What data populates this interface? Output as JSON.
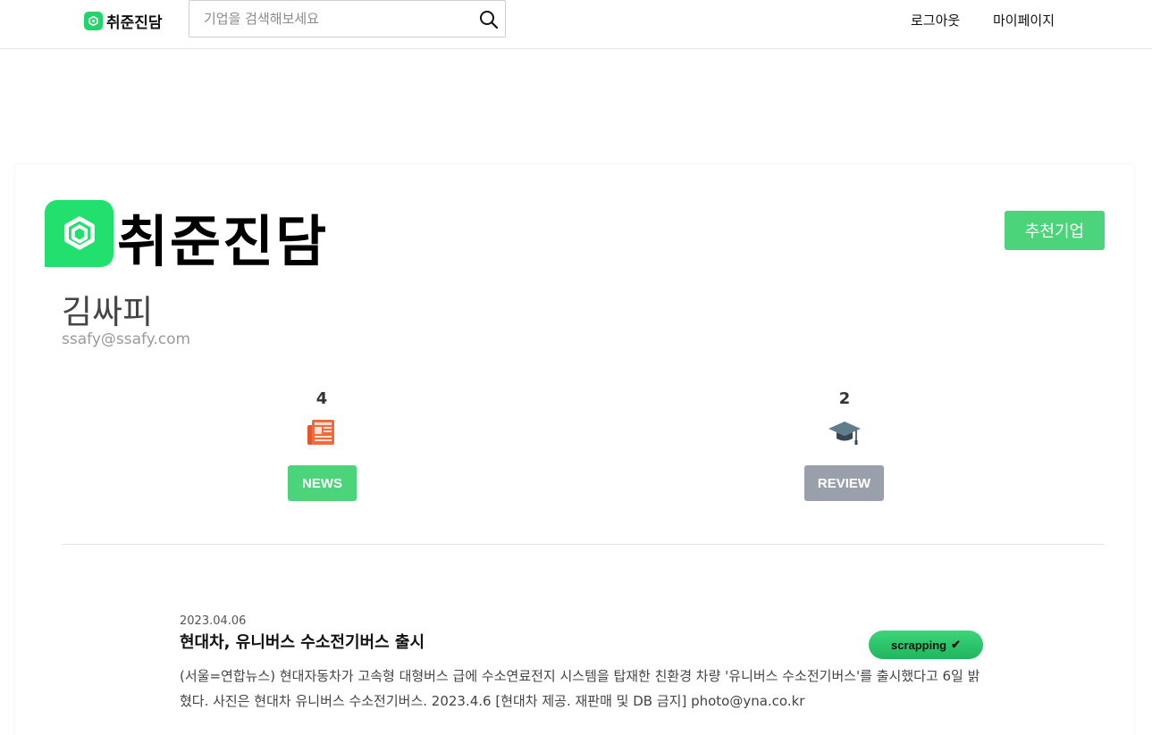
{
  "header": {
    "brand": "취준진담",
    "search_placeholder": "기업을 검색해보세요",
    "nav": {
      "logout": "로그아웃",
      "mypage": "마이페이지"
    }
  },
  "profile": {
    "brand": "취준진담",
    "recommend_label": "추천기업",
    "name": "김싸피",
    "email": "ssafy@ssafy.com"
  },
  "stats": {
    "news": {
      "count": "4",
      "label": "NEWS",
      "icon": "newspaper-icon"
    },
    "review": {
      "count": "2",
      "label": "REVIEW",
      "icon": "graduation-cap-icon"
    }
  },
  "news_list": [
    {
      "date": "2023.04.06",
      "title": "현대차, 유니버스 수소전기버스 출시",
      "body": "(서울=연합뉴스) 현대자동차가 고속형 대형버스 급에 수소연료전지 시스템을 탑재한 친환경 차량 '유니버스 수소전기버스'를 출시했다고 6일 밝혔다. 사진은 현대차 유니버스 수소전기버스. 2023.4.6 [현대차 제공. 재판매 및 DB 금지] photo@yna.co.kr",
      "scrap_label": "scrapping",
      "scrap_mark": "✔"
    }
  ],
  "colors": {
    "accent": "#4cd47a",
    "logo": "#22e06e",
    "review_button": "#9aa0ab"
  }
}
